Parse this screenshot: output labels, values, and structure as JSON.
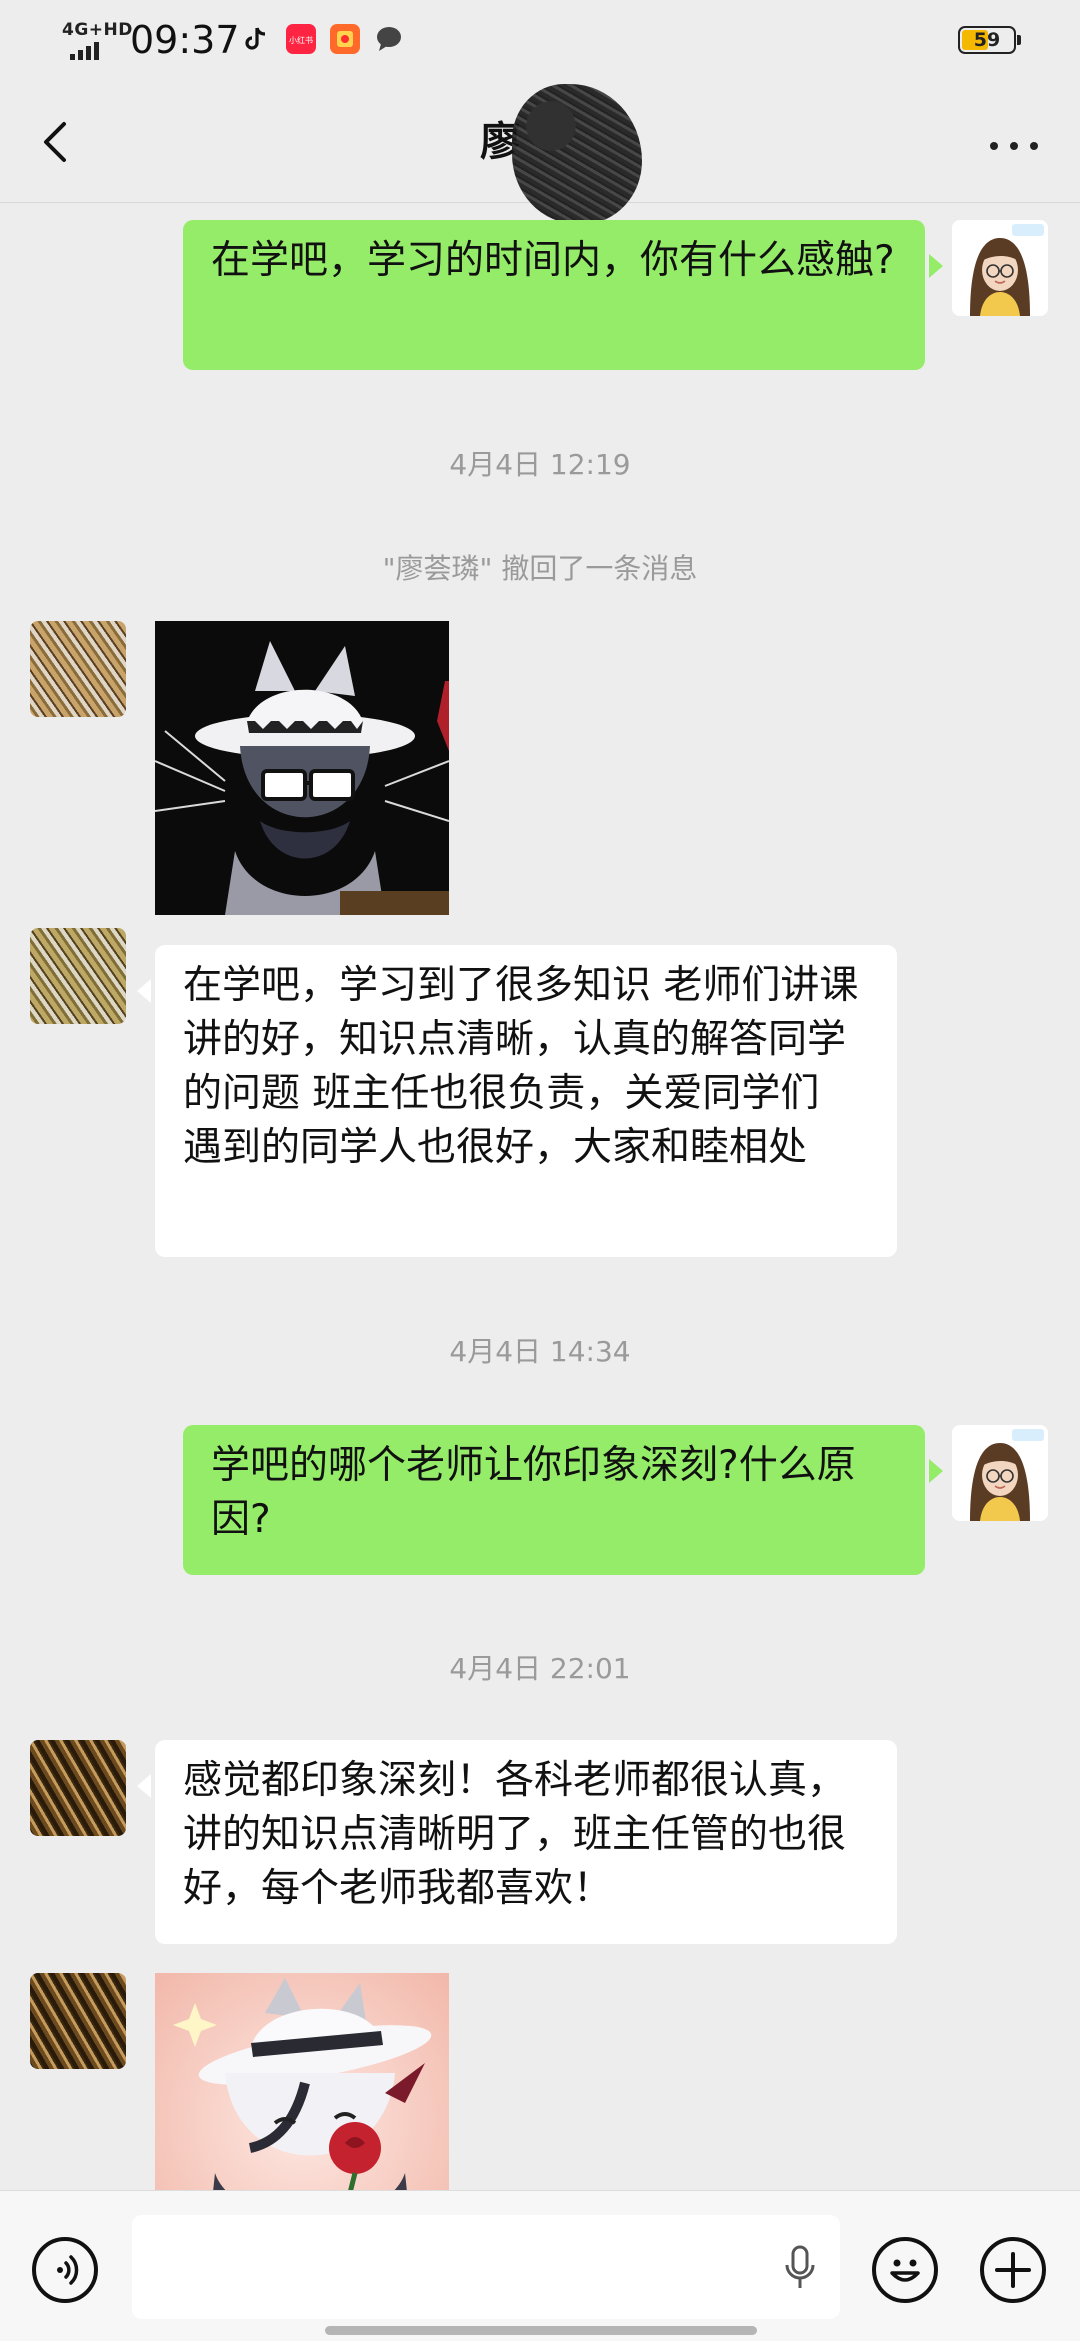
{
  "status_bar": {
    "network": "4G+HD",
    "time": "09:37",
    "battery": "59",
    "app_icons": [
      "tiktok-icon",
      "xiaohongshu-icon",
      "game-app-icon",
      "message-bubble-icon"
    ]
  },
  "header": {
    "title": "廖",
    "back_icon": "chevron-left-icon",
    "more_icon": "more-dots-icon"
  },
  "messages": [
    {
      "type": "text",
      "sender": "me",
      "text": "在学吧，学习的时间内，你有什么感触?"
    },
    {
      "type": "time",
      "text": "4月4日 12:19"
    },
    {
      "type": "system",
      "text": "\"廖荟璘\" 撤回了一条消息"
    },
    {
      "type": "sticker",
      "sender": "them",
      "description": "cat-with-hat-sticker"
    },
    {
      "type": "text",
      "sender": "them",
      "text": "在学吧，学习到了很多知识  老师们讲课讲的好，知识点清晰，认真的解答同学的问题  班主任也很负责，关爱同学们  遇到的同学人也很好，大家和睦相处"
    },
    {
      "type": "time",
      "text": "4月4日 14:34"
    },
    {
      "type": "text",
      "sender": "me",
      "text": "学吧的哪个老师让你印象深刻?什么原因?"
    },
    {
      "type": "time",
      "text": "4月4日 22:01"
    },
    {
      "type": "text",
      "sender": "them",
      "text": "感觉都印象深刻！各科老师都很认真，讲的知识点清晰明了，班主任管的也很好，每个老师我都喜欢！"
    },
    {
      "type": "sticker",
      "sender": "them",
      "description": "cat-with-rose-sticker"
    }
  ],
  "colors": {
    "background": "#ededed",
    "my_bubble": "#95ec69",
    "their_bubble": "#ffffff",
    "timestamp_text": "#9a9a9a",
    "battery_fill": "#f5b800"
  },
  "input_bar": {
    "voice_icon": "voice-mode-icon",
    "mic_icon": "microphone-icon",
    "emoji_icon": "emoji-icon",
    "plus_icon": "plus-icon"
  }
}
